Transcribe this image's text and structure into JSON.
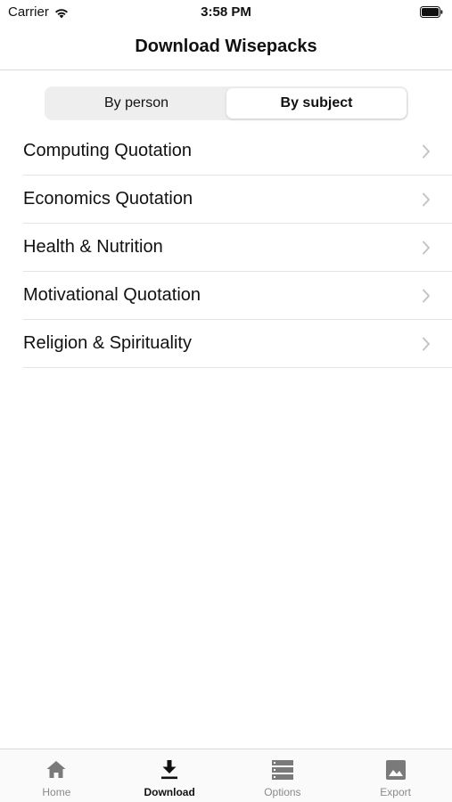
{
  "status_bar": {
    "carrier": "Carrier",
    "time": "3:58 PM",
    "wifi_icon": "wifi-icon",
    "battery_icon": "battery-icon"
  },
  "nav": {
    "title": "Download Wisepacks"
  },
  "segmented": {
    "options": [
      {
        "label": "By person",
        "selected": false
      },
      {
        "label": "By subject",
        "selected": true
      }
    ]
  },
  "list": {
    "items": [
      {
        "label": "Computing Quotation"
      },
      {
        "label": "Economics Quotation"
      },
      {
        "label": "Health & Nutrition"
      },
      {
        "label": "Motivational Quotation"
      },
      {
        "label": "Religion & Spirituality"
      }
    ],
    "chevron_icon": "chevron-right-icon"
  },
  "tab_bar": {
    "tabs": [
      {
        "label": "Home",
        "icon": "home-icon",
        "active": false
      },
      {
        "label": "Download",
        "icon": "download-icon",
        "active": true
      },
      {
        "label": "Options",
        "icon": "options-icon",
        "active": false
      },
      {
        "label": "Export",
        "icon": "image-icon",
        "active": false
      }
    ]
  },
  "colors": {
    "active_tab": "#111111",
    "inactive_tab": "#8a8a8a",
    "segment_bg": "#eeeeef",
    "chevron": "#c4c4c6"
  }
}
